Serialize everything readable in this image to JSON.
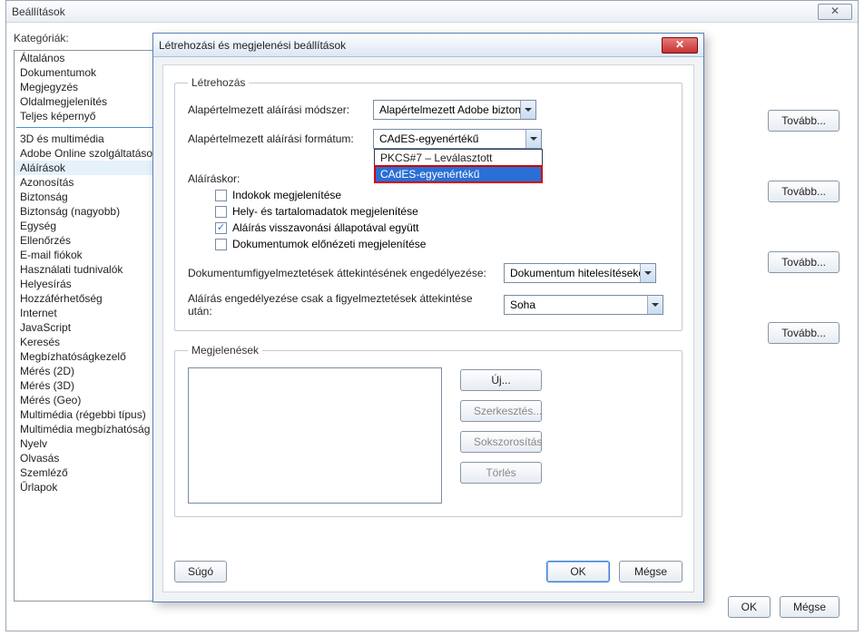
{
  "outer": {
    "title": "Beállítások",
    "close_glyph": "✕",
    "categories_label": "Kategóriák:",
    "categories_top": [
      "Általános",
      "Dokumentumok",
      "Megjegyzés",
      "Oldalmegjelenítés",
      "Teljes képernyő"
    ],
    "categories_rest": [
      "3D és multimédia",
      "Adobe Online szolgáltatások",
      "Aláírások",
      "Azonosítás",
      "Biztonság",
      "Biztonság (nagyobb)",
      "Egység",
      "Ellenőrzés",
      "E-mail fiókok",
      "Használati tudnivalók",
      "Helyesírás",
      "Hozzáférhetőség",
      "Internet",
      "JavaScript",
      "Keresés",
      "Megbízhatóságkezelő",
      "Mérés (2D)",
      "Mérés (3D)",
      "Mérés (Geo)",
      "Multimédia (régebbi típus)",
      "Multimédia megbízhatóság",
      "Nyelv",
      "Olvasás",
      "Szemléző",
      "Űrlapok"
    ],
    "categories_selected": "Aláírások",
    "right_buttons": [
      "Tovább...",
      "Tovább...",
      "Tovább...",
      "Tovább..."
    ],
    "bottom_ok": "OK",
    "bottom_cancel": "Mégse"
  },
  "dialog": {
    "title": "Létrehozási és megjelenési beállítások",
    "close_glyph": "✕",
    "group_creation_title": "Létrehozás",
    "label_signing_method": "Alapértelmezett aláírási módszer:",
    "combo_signing_method_value": "Alapértelmezett Adobe bizton",
    "label_signing_format": "Alapértelmezett aláírási formátum:",
    "combo_signing_format_value": "CAdES-egyenértékű",
    "combo_signing_format_options": [
      "PKCS#7 – Leválasztott",
      "CAdES-egyenértékű"
    ],
    "combo_signing_format_highlight": "CAdES-egyenértékű",
    "label_when_signing": "Aláíráskor:",
    "chk_reasons": "Indokok megjelenítése",
    "chk_location": "Hely- és tartalomadatok megjelenítése",
    "chk_revocation": "Aláírás visszavonási állapotával együtt",
    "chk_preview": "Dokumentumok előnézeti megjelenítése",
    "chk_revocation_checked": true,
    "label_doc_warnings": "Dokumentumfigyelmeztetések áttekintésének engedélyezése:",
    "combo_doc_warnings_value": "Dokumentum hitelesítésekor",
    "label_allow_sign_only": "Aláírás engedélyezése csak a figyelmeztetések áttekintése után:",
    "combo_allow_sign_only_value": "Soha",
    "group_appearances_title": "Megjelenések",
    "btn_new": "Új...",
    "btn_edit": "Szerkesztés...",
    "btn_duplicate": "Sokszorosítás",
    "btn_delete": "Törlés",
    "btn_help": "Súgó",
    "btn_ok": "OK",
    "btn_cancel": "Mégse"
  }
}
